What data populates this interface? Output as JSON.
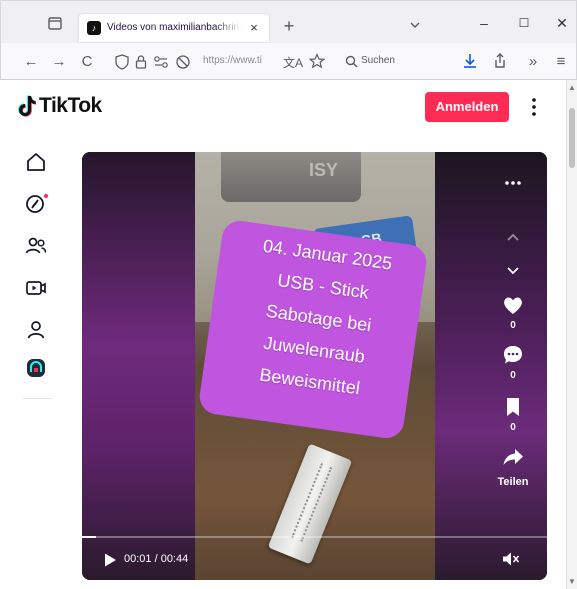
{
  "browser": {
    "tab": {
      "title": "Videos von maximilianbachring",
      "close_glyph": "×"
    },
    "new_tab_glyph": "+",
    "window": {
      "minimize": "–",
      "maximize": "☐",
      "close": "✕"
    },
    "nav": {
      "back": "←",
      "forward": "→",
      "reload": "C"
    },
    "url": {
      "text": "https://www.ti"
    },
    "search": {
      "placeholder": "Suchen"
    },
    "toolbar": {
      "overflow": "»",
      "menu": "≡"
    }
  },
  "tiktok": {
    "logo_text": "TikTok",
    "login_label": "Anmelden",
    "sidebar": [
      "home-icon",
      "explore-icon",
      "following-icon",
      "live-icon",
      "profile-icon",
      "app-icon"
    ],
    "video": {
      "overlay_lines": [
        "04. Januar 2025",
        "USB - Stick",
        "Sabotage bei",
        "Juwelenraub",
        "Beweismittel"
      ],
      "background_label": "ISY",
      "card_label": "GB",
      "likes": "0",
      "comments": "0",
      "saves": "0",
      "share_label": "Teilen",
      "time": "00:01 / 00:44",
      "progress": 0.03
    }
  },
  "colors": {
    "brand": "#fe2c55",
    "overlay": "#c055e0"
  }
}
